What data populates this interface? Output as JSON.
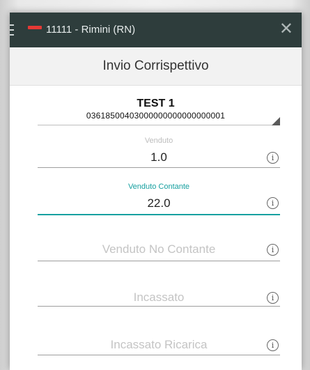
{
  "appbar": {
    "title": "11111 - Rimini (RN)",
    "menu_icon": "hamburger-icon",
    "close_icon": "close-icon",
    "close_symbol": "✕",
    "logo_color": "#e53935",
    "background": "#2e3d3c"
  },
  "subheader": {
    "title": "Invio Corrispettivo"
  },
  "device_select": {
    "name": "TEST 1",
    "serial": "03618500403000000000000000001"
  },
  "fields": {
    "venduto": {
      "label": "Venduto",
      "value": "1.0"
    },
    "venduto_contante": {
      "label": "Venduto Contante",
      "value": "22.0"
    },
    "venduto_no_contante": {
      "placeholder": "Venduto No Contante"
    },
    "incassato": {
      "placeholder": "Incassato"
    },
    "incassato_ricarica": {
      "placeholder": "Incassato Ricarica"
    }
  },
  "info_icon_glyph": "i",
  "accent_color": "#17a0a0"
}
